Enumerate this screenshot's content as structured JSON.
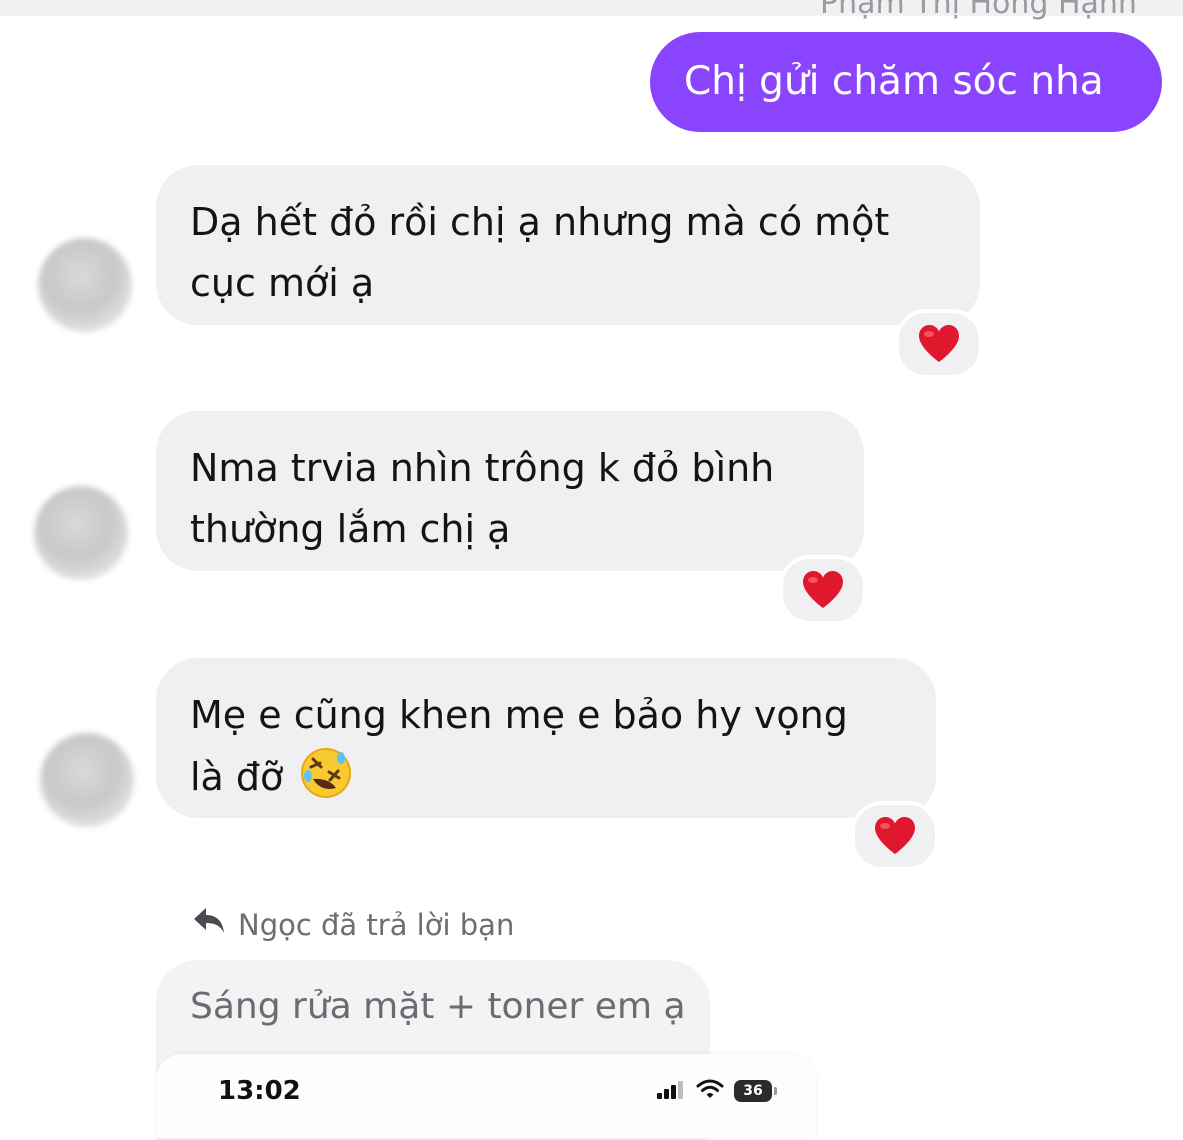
{
  "header": {
    "sender_name_cut": "Phạm Thị Hồng Hạnh"
  },
  "messages": [
    {
      "side": "sent",
      "text": "Chị gửi chăm sóc nha"
    },
    {
      "side": "received",
      "lines": [
        "Dạ hết đỏ rồi chị ạ nhưng mà có một",
        "cục mới ạ"
      ],
      "reaction": "red-heart"
    },
    {
      "side": "received",
      "lines": [
        "Nma trvia nhìn trông k đỏ bình",
        "thường lắm chị ạ"
      ],
      "reaction": "red-heart"
    },
    {
      "side": "received",
      "lines": [
        "Mẹ e cũng khen mẹ e bảo hy vọng",
        "là đỡ"
      ],
      "emoji": "rolling-on-floor-laughing",
      "reaction": "red-heart"
    }
  ],
  "reply": {
    "label": "Ngọc đã trả lời bạn",
    "quoted_text": "Sáng rửa mặt + toner em ạ",
    "attachment": {
      "time": "13:02",
      "battery": "36"
    }
  },
  "colors": {
    "sent_bubble": "#8b44fd",
    "received_bubble": "#f0f0f3",
    "heart": "#e0182d"
  }
}
